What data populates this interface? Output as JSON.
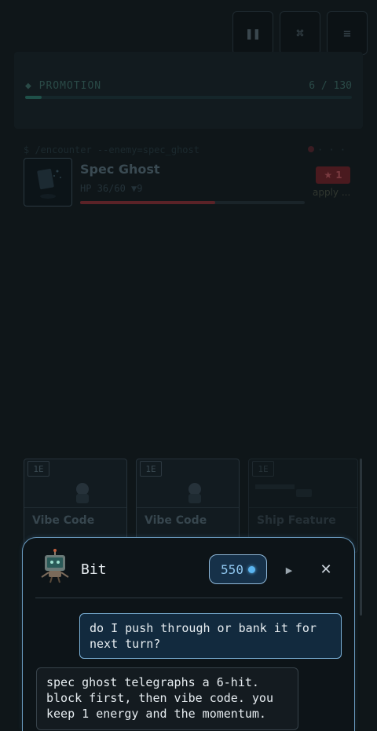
{
  "toolbar": {
    "pause_icon": "pause-icon",
    "command_icon": "command-icon",
    "menu_icon": "menu-icon"
  },
  "promotion": {
    "label": "◆ PROMOTION",
    "count": "6 / 130",
    "progress": 0.05
  },
  "encounter": {
    "path": "$ /encounter --enemy=spec_ghost",
    "enemy_name": "Spec Ghost",
    "hp_text": "HP 36/60 ▼9",
    "hp_fraction": 0.6,
    "badge": "★ 1",
    "apply_label": "apply ..."
  },
  "hand": [
    {
      "cost": "1E",
      "name": "Vibe Code"
    },
    {
      "cost": "1E",
      "name": "Vibe Code"
    },
    {
      "cost": "1E",
      "name": "Ship Feature"
    }
  ],
  "chat": {
    "name": "Bit",
    "coins": "550",
    "messages": {
      "user": "do I push through or bank it for next turn?",
      "bot": "spec ghost telegraphs a 6-hit. block first, then vibe code. you keep 1 energy and the momentum."
    }
  },
  "colors": {
    "panel_border": "#6a9bc0",
    "coin": "#5bb5f0",
    "user_bubble": "#122a3e"
  }
}
